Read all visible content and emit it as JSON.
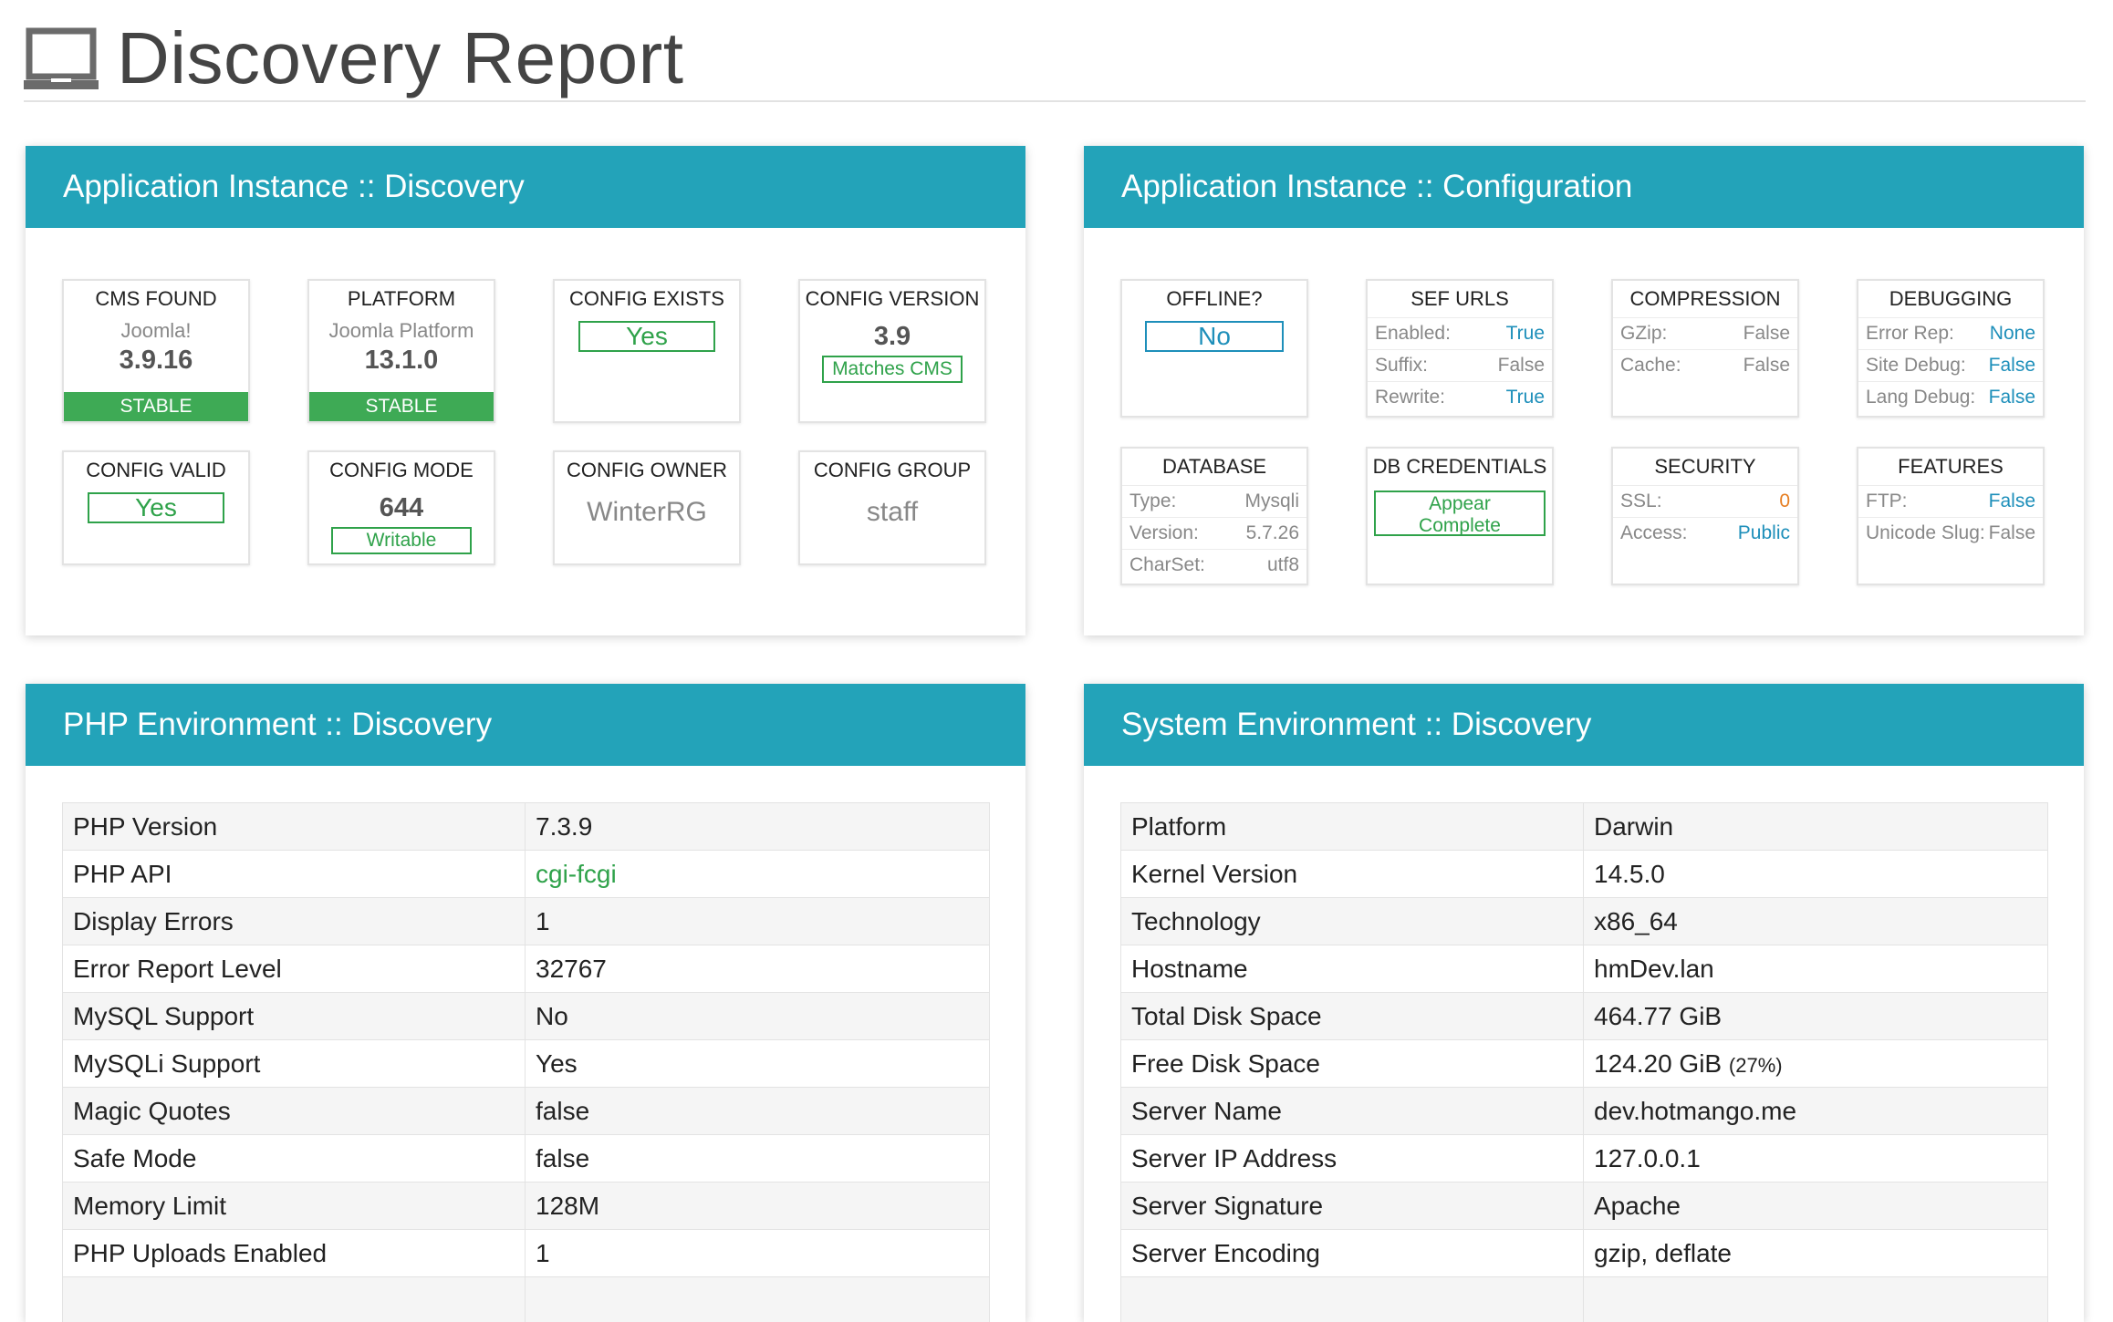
{
  "header": {
    "title": "Discovery Report",
    "icon": "laptop-icon"
  },
  "colors": {
    "panel_header": "#23a3b9",
    "success": "#3eaa55",
    "link_blue": "#1e8fba",
    "warning": "#e67e22"
  },
  "discovery": {
    "title": "Application Instance :: Discovery",
    "cms_found": {
      "title": "CMS FOUND",
      "name": "Joomla!",
      "version": "3.9.16",
      "status": "STABLE"
    },
    "platform": {
      "title": "PLATFORM",
      "name": "Joomla Platform",
      "version": "13.1.0",
      "status": "STABLE"
    },
    "config_exists": {
      "title": "CONFIG EXISTS",
      "value": "Yes"
    },
    "config_version": {
      "title": "CONFIG VERSION",
      "version": "3.9",
      "match": "Matches CMS"
    },
    "config_valid": {
      "title": "CONFIG VALID",
      "value": "Yes"
    },
    "config_mode": {
      "title": "CONFIG MODE",
      "mode": "644",
      "status": "Writable"
    },
    "config_owner": {
      "title": "CONFIG OWNER",
      "value": "WinterRG"
    },
    "config_group": {
      "title": "CONFIG GROUP",
      "value": "staff"
    }
  },
  "configuration": {
    "title": "Application Instance :: Configuration",
    "offline": {
      "title": "OFFLINE?",
      "value": "No"
    },
    "sef_urls": {
      "title": "SEF URLS",
      "rows": [
        {
          "k": "Enabled:",
          "v": "True"
        },
        {
          "k": "Suffix:",
          "v": "False"
        },
        {
          "k": "Rewrite:",
          "v": "True"
        }
      ]
    },
    "compression": {
      "title": "COMPRESSION",
      "rows": [
        {
          "k": "GZip:",
          "v": "False"
        },
        {
          "k": "Cache:",
          "v": "False"
        }
      ]
    },
    "debugging": {
      "title": "DEBUGGING",
      "rows": [
        {
          "k": "Error Rep:",
          "v": "None"
        },
        {
          "k": "Site Debug:",
          "v": "False"
        },
        {
          "k": "Lang Debug:",
          "v": "False"
        }
      ]
    },
    "database": {
      "title": "DATABASE",
      "rows": [
        {
          "k": "Type:",
          "v": "Mysqli"
        },
        {
          "k": "Version:",
          "v": "5.7.26"
        },
        {
          "k": "CharSet:",
          "v": "utf8"
        }
      ]
    },
    "db_credentials": {
      "title": "DB CREDENTIALS",
      "line1": "Appear",
      "line2": "Complete"
    },
    "security": {
      "title": "SECURITY",
      "rows": [
        {
          "k": "SSL:",
          "v": "0"
        },
        {
          "k": "Access:",
          "v": "Public"
        }
      ]
    },
    "features": {
      "title": "FEATURES",
      "rows": [
        {
          "k": "FTP:",
          "v": "False"
        },
        {
          "k": "Unicode Slug:",
          "v": "False"
        }
      ]
    }
  },
  "php": {
    "title": "PHP Environment :: Discovery",
    "rows": [
      {
        "k": "PHP Version",
        "v": "7.3.9"
      },
      {
        "k": "PHP API",
        "v": "cgi-fcgi"
      },
      {
        "k": "Display Errors",
        "v": "1"
      },
      {
        "k": "Error Report Level",
        "v": "32767"
      },
      {
        "k": "MySQL Support",
        "v": "No"
      },
      {
        "k": "MySQLi Support",
        "v": "Yes"
      },
      {
        "k": "Magic Quotes",
        "v": "false"
      },
      {
        "k": "Safe Mode",
        "v": "false"
      },
      {
        "k": "Memory Limit",
        "v": "128M"
      },
      {
        "k": "PHP Uploads Enabled",
        "v": "1"
      },
      {
        "k": "",
        "v": ""
      }
    ]
  },
  "system": {
    "title": "System Environment :: Discovery",
    "rows": [
      {
        "k": "Platform",
        "v": "Darwin"
      },
      {
        "k": "Kernel Version",
        "v": "14.5.0"
      },
      {
        "k": "Technology",
        "v": "x86_64"
      },
      {
        "k": "Hostname",
        "v": "hmDev.lan"
      },
      {
        "k": "Total Disk Space",
        "v": "464.77 GiB"
      },
      {
        "k": "Free Disk Space",
        "v": "124.20 GiB",
        "extra": "(27%)"
      },
      {
        "k": "Server Name",
        "v": "dev.hotmango.me"
      },
      {
        "k": "Server IP Address",
        "v": "127.0.0.1"
      },
      {
        "k": "Server Signature",
        "v": "Apache"
      },
      {
        "k": "Server Encoding",
        "v": "gzip, deflate"
      },
      {
        "k": "",
        "v": ""
      }
    ]
  }
}
